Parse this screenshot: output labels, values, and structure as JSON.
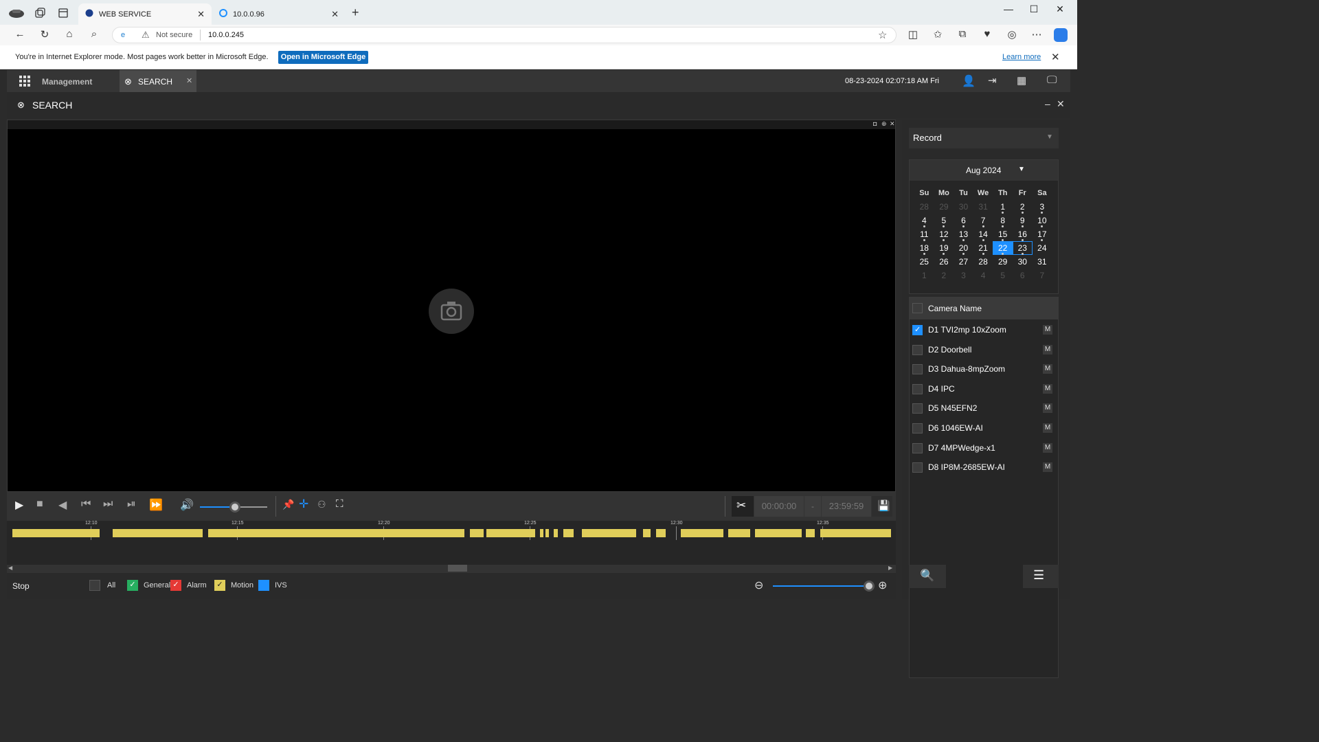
{
  "browser": {
    "tabs": [
      {
        "label": "WEB SERVICE"
      },
      {
        "label": "10.0.0.96"
      }
    ],
    "not_secure": "Not secure",
    "url": "10.0.0.245",
    "ie_notice": "You're in Internet Explorer mode. Most pages work better in Microsoft Edge.",
    "ie_button": "Open in Microsoft Edge",
    "learn_more": "Learn more"
  },
  "app": {
    "management": "Management",
    "search_tab": "SEARCH",
    "datetime": "08-23-2024 02:07:18 AM Fri",
    "panel_title": "SEARCH"
  },
  "controls": {
    "time_start": "00:00:00",
    "time_sep": "-",
    "time_end": "23:59:59",
    "status": "Stop"
  },
  "timeline": {
    "ticks": [
      "12:10",
      "12:15",
      "12:20",
      "12:25",
      "12:30",
      "12:35"
    ],
    "segments": [
      [
        18,
        145
      ],
      [
        164,
        295
      ],
      [
        303,
        676
      ],
      [
        684,
        704
      ],
      [
        708,
        779
      ],
      [
        786,
        791
      ],
      [
        794,
        799
      ],
      [
        806,
        812
      ],
      [
        820,
        835
      ],
      [
        847,
        926
      ],
      [
        936,
        947
      ],
      [
        955,
        969
      ],
      [
        991,
        1053
      ],
      [
        1060,
        1092
      ],
      [
        1099,
        1167
      ],
      [
        1173,
        1186
      ],
      [
        1194,
        1297
      ]
    ]
  },
  "legend": {
    "all": "All",
    "general": "General",
    "alarm": "Alarm",
    "motion": "Motion",
    "ivs": "IVS"
  },
  "right": {
    "record_type": "Record",
    "month": "Aug 2024",
    "weekdays": [
      "Su",
      "Mo",
      "Tu",
      "We",
      "Th",
      "Fr",
      "Sa"
    ],
    "weeks": [
      [
        [
          "28",
          0,
          0
        ],
        [
          "29",
          0,
          0
        ],
        [
          "30",
          0,
          0
        ],
        [
          "31",
          0,
          0
        ],
        [
          "1",
          1,
          1
        ],
        [
          "2",
          1,
          1
        ],
        [
          "3",
          1,
          1
        ]
      ],
      [
        [
          "4",
          1,
          1
        ],
        [
          "5",
          1,
          1
        ],
        [
          "6",
          1,
          1
        ],
        [
          "7",
          1,
          1
        ],
        [
          "8",
          1,
          1
        ],
        [
          "9",
          1,
          1
        ],
        [
          "10",
          1,
          1
        ]
      ],
      [
        [
          "11",
          1,
          1
        ],
        [
          "12",
          1,
          1
        ],
        [
          "13",
          1,
          1
        ],
        [
          "14",
          1,
          1
        ],
        [
          "15",
          1,
          1
        ],
        [
          "16",
          1,
          1
        ],
        [
          "17",
          1,
          1
        ]
      ],
      [
        [
          "18",
          1,
          1
        ],
        [
          "19",
          1,
          1
        ],
        [
          "20",
          1,
          1
        ],
        [
          "21",
          1,
          1
        ],
        [
          "22",
          1,
          1
        ],
        [
          "23",
          1,
          1
        ],
        [
          "24",
          1,
          0
        ]
      ],
      [
        [
          "25",
          1,
          0
        ],
        [
          "26",
          1,
          0
        ],
        [
          "27",
          1,
          0
        ],
        [
          "28",
          1,
          0
        ],
        [
          "29",
          1,
          0
        ],
        [
          "30",
          1,
          0
        ],
        [
          "31",
          1,
          0
        ]
      ],
      [
        [
          "1",
          0,
          0
        ],
        [
          "2",
          0,
          0
        ],
        [
          "3",
          0,
          0
        ],
        [
          "4",
          0,
          0
        ],
        [
          "5",
          0,
          0
        ],
        [
          "6",
          0,
          0
        ],
        [
          "7",
          0,
          0
        ]
      ]
    ],
    "selected_day": "22",
    "today": "23",
    "camera_header": "Camera Name",
    "cameras": [
      {
        "name": "D1 TVI2mp 10xZoom",
        "checked": true,
        "m": "M"
      },
      {
        "name": "D2 Doorbell",
        "checked": false,
        "m": "M"
      },
      {
        "name": "D3 Dahua-8mpZoom",
        "checked": false,
        "m": "M"
      },
      {
        "name": "D4 IPC",
        "checked": false,
        "m": "M"
      },
      {
        "name": "D5 N45EFN2",
        "checked": false,
        "m": "M"
      },
      {
        "name": "D6 1046EW-AI",
        "checked": false,
        "m": "M"
      },
      {
        "name": "D7 4MPWedge-x1",
        "checked": false,
        "m": "M"
      },
      {
        "name": "D8 IP8M-2685EW-AI",
        "checked": false,
        "m": "M"
      }
    ]
  },
  "colors": {
    "accent": "#1e90ff",
    "record": "#e0ce5a",
    "general": "#27ae60",
    "alarm": "#e53935",
    "motion": "#e0ce5a",
    "ivs": "#1e90ff"
  }
}
